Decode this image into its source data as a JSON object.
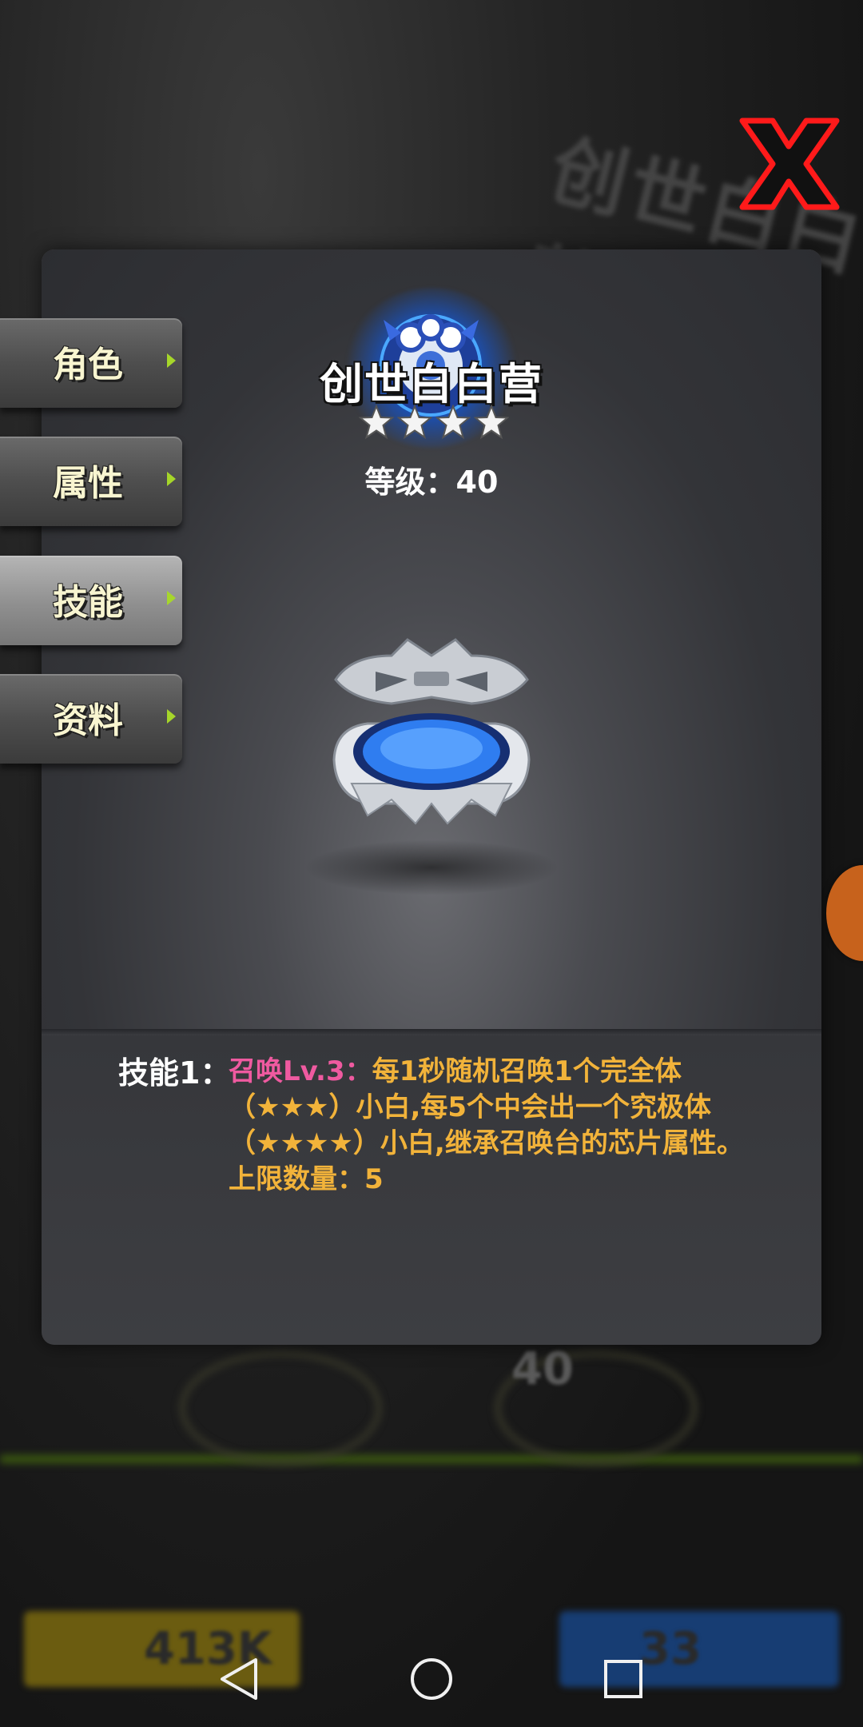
{
  "header": {
    "title": "创世白白营",
    "stars": 4,
    "level_label": "等级：40"
  },
  "tabs": [
    {
      "label": "角色",
      "active": false
    },
    {
      "label": "属性",
      "active": false
    },
    {
      "label": "技能",
      "active": true
    },
    {
      "label": "资料",
      "active": false
    }
  ],
  "skill": {
    "label": "技能1：",
    "name": "召唤Lv.3：",
    "description": "每1秒随机召唤1个完全体（★★★）小白,每5个中会出一个究极体（★★★★）小白,继承召唤台的芯片属性。上限数量：5"
  },
  "background": {
    "level_number": "40",
    "left_bar_value": "413K",
    "right_bar_value": "33"
  },
  "colors": {
    "skill_name": "#ef5aa0",
    "skill_desc": "#f2b33a",
    "active_tab": "#8f8f8f",
    "tab_arrow": "#a6d62a",
    "close_red": "#e01010"
  },
  "icons": {
    "close": "close-x-icon",
    "star": "star-icon",
    "back": "back-triangle-icon",
    "home": "home-circle-icon",
    "recents": "recents-square-icon"
  }
}
